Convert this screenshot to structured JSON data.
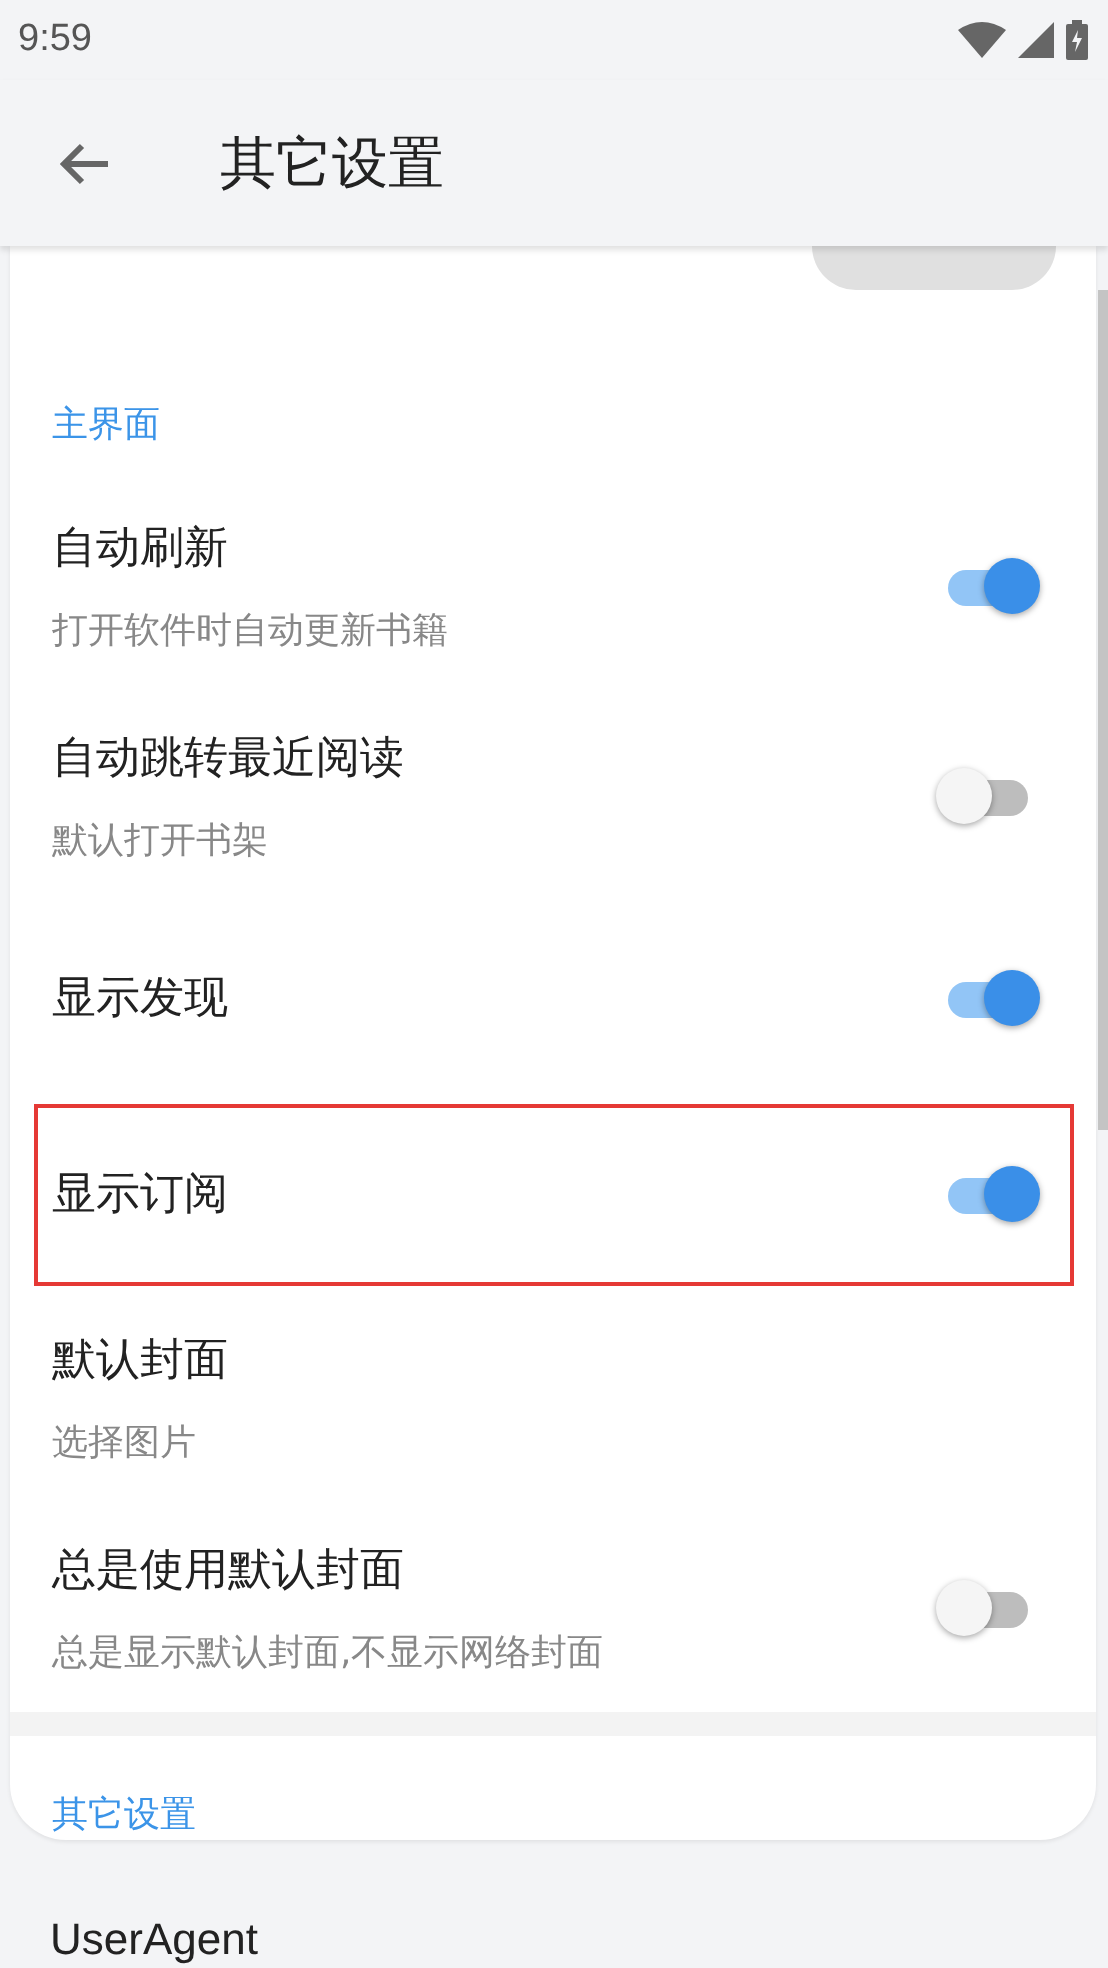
{
  "status_bar": {
    "time": "9:59"
  },
  "app_bar": {
    "title": "其它设置"
  },
  "sections": [
    {
      "title": "主界面",
      "items": [
        {
          "kind": "switch",
          "title": "自动刷新",
          "subtitle": "打开软件时自动更新书籍",
          "on": true,
          "highlighted": false
        },
        {
          "kind": "switch",
          "title": "自动跳转最近阅读",
          "subtitle": "默认打开书架",
          "on": false,
          "highlighted": false
        },
        {
          "kind": "switch",
          "title": "显示发现",
          "on": true,
          "highlighted": false
        },
        {
          "kind": "switch",
          "title": "显示订阅",
          "on": true,
          "highlighted": true
        },
        {
          "kind": "link",
          "title": "默认封面",
          "subtitle": "选择图片",
          "highlighted": false
        },
        {
          "kind": "switch",
          "title": "总是使用默认封面",
          "subtitle": "总是显示默认封面,不显示网络封面",
          "on": false,
          "highlighted": false
        }
      ]
    },
    {
      "title": "其它设置"
    }
  ],
  "rows_below": [
    {
      "title": "UserAgent"
    }
  ]
}
